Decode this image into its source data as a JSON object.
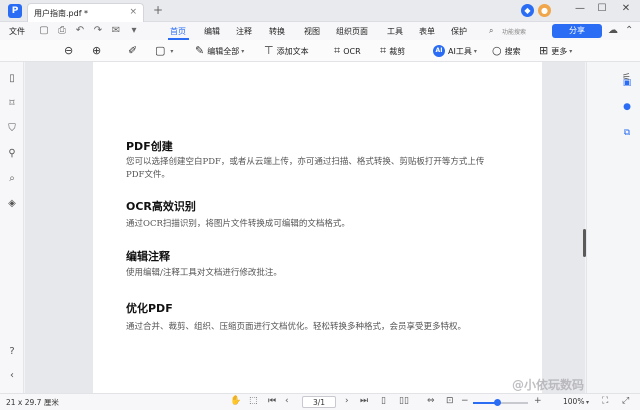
{
  "titlebar": {
    "tab_title": "用户指南.pdf *",
    "tab_close": "×",
    "new_tab": "+",
    "minimize": "—",
    "maximize": "☐",
    "close": "✕"
  },
  "menubar": {
    "file": "文件",
    "tabs": [
      "首页",
      "编辑",
      "注释",
      "转换",
      "视图",
      "组织页面",
      "工具",
      "表单",
      "保护"
    ],
    "active_tab": "首页",
    "search_feature": "功能搜索",
    "share": "分享"
  },
  "toolbar": {
    "edit_all": "编辑全部",
    "add_text": "添加文本",
    "ocr": "OCR",
    "crop": "裁剪",
    "ai_tools": "AI工具",
    "search": "搜索",
    "more": "更多"
  },
  "document": {
    "sections": [
      {
        "heading": "PDF创建",
        "body": "您可以选择创建空白PDF，或者从云端上传，亦可通过扫描、格式转换、剪贴板打开等方式上传PDF文件。"
      },
      {
        "heading": "OCR高效识别",
        "body": "通过OCR扫描识别，将图片文件转换成可编辑的文档格式。"
      },
      {
        "heading": "编辑注释",
        "body": "使用编辑/注释工具对文档进行修改批注。"
      },
      {
        "heading": "优化PDF",
        "body": "通过合并、裁剪、组织、压缩页面进行文档优化。轻松转换多种格式，会员享受更多特权。"
      }
    ]
  },
  "statusbar": {
    "page_size": "21 x 29.7 厘米",
    "page_current": "3",
    "page_total": "/1",
    "zoom": "100%",
    "zoom_fraction": 0.45
  },
  "watermark": "@小依玩数码",
  "colors": {
    "accent": "#2a6df4",
    "page_bg": "#ffffff",
    "canvas_bg": "#e7e8eb"
  }
}
